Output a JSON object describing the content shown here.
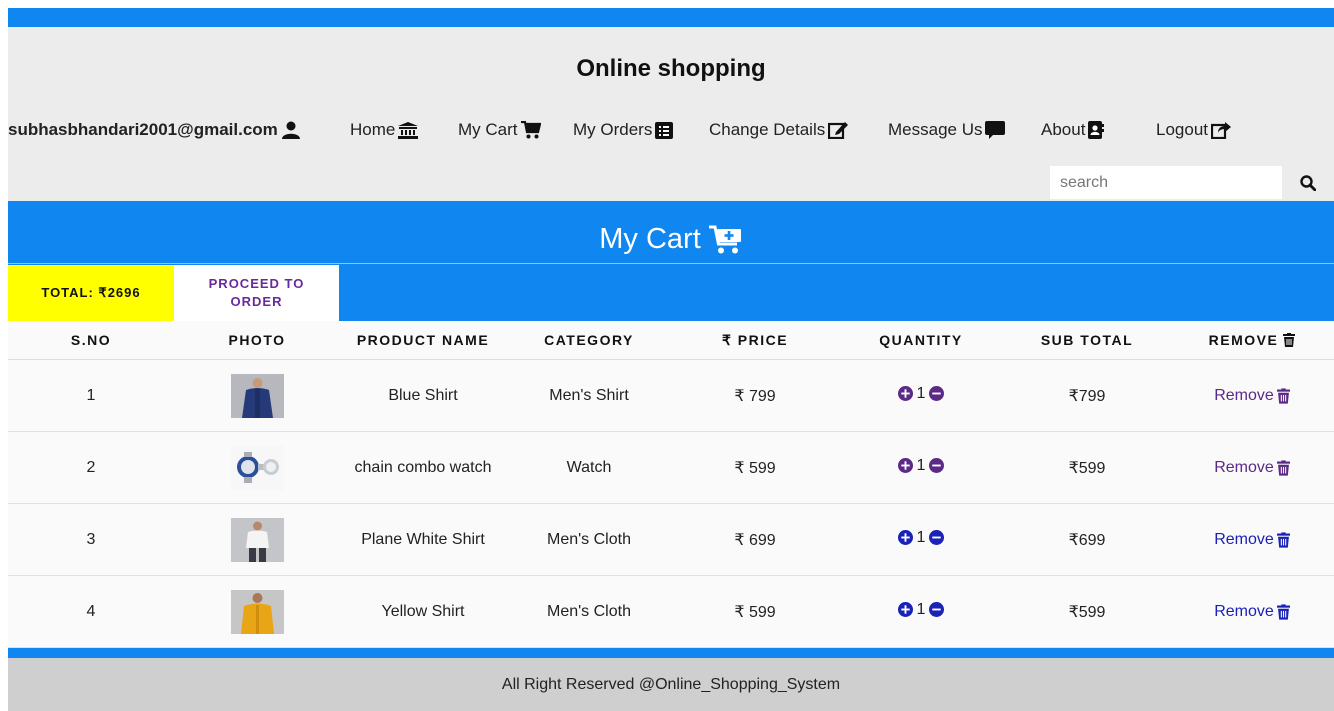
{
  "header": {
    "title": "Online shopping"
  },
  "nav": {
    "user_email": "subhasbhandari2001@gmail.com",
    "items": [
      {
        "label": "Home",
        "icon": "bank-icon"
      },
      {
        "label": "My Cart",
        "icon": "cart-icon"
      },
      {
        "label": "My Orders",
        "icon": "list-alt-icon"
      },
      {
        "label": "Change Details",
        "icon": "edit-icon"
      },
      {
        "label": "Message Us",
        "icon": "comment-icon"
      },
      {
        "label": "About",
        "icon": "address-book-icon"
      },
      {
        "label": "Logout",
        "icon": "share-square-icon"
      }
    ]
  },
  "search": {
    "placeholder": "search",
    "value": ""
  },
  "cart": {
    "title": "My Cart",
    "total": "TOTAL: ₹2696",
    "proceed_label": "PROCEED TO ORDER",
    "columns": [
      "S.NO",
      "PHOTO",
      "PRODUCT NAME",
      "CATEGORY",
      "₹ PRICE",
      "QUANTITY",
      "SUB TOTAL",
      "REMOVE"
    ],
    "remove_label": "Remove",
    "rows": [
      {
        "sno": "1",
        "product": "Blue Shirt",
        "category": "Men's Shirt",
        "price": "₹ 799",
        "quantity": "1",
        "subtotal": "₹799"
      },
      {
        "sno": "2",
        "product": "chain combo watch",
        "category": "Watch",
        "price": "₹ 599",
        "quantity": "1",
        "subtotal": "₹599"
      },
      {
        "sno": "3",
        "product": "Plane White Shirt",
        "category": "Men's Cloth",
        "price": "₹ 699",
        "quantity": "1",
        "subtotal": "₹699"
      },
      {
        "sno": "4",
        "product": "Yellow Shirt",
        "category": "Men's Cloth",
        "price": "₹ 599",
        "quantity": "1",
        "subtotal": "₹599"
      }
    ]
  },
  "footer": {
    "text": "All Right Reserved @Online_Shopping_System"
  },
  "colors": {
    "accent_blue": "#1086f0",
    "total_yellow": "#ffff00",
    "proceed_purple": "#6a2a9a",
    "link_purple": "#5b2a86",
    "link_blue": "#1a22b8"
  }
}
